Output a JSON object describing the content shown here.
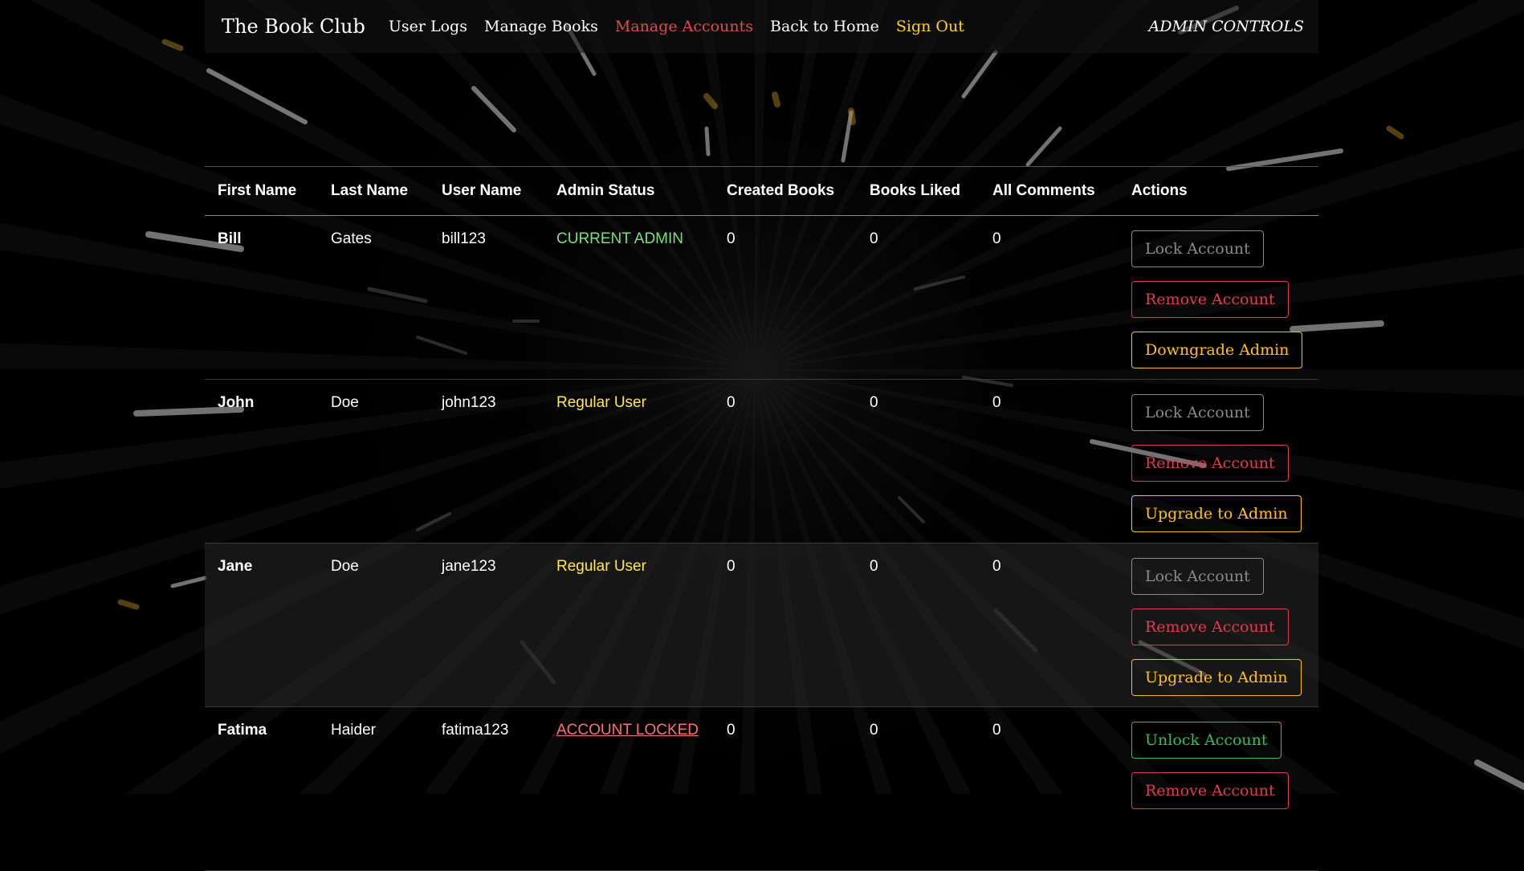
{
  "nav": {
    "brand": "The Book Club",
    "links": [
      "User Logs",
      "Manage Books",
      "Manage Accounts",
      "Back to Home",
      "Sign Out"
    ],
    "right_label": "ADMIN CONTROLS"
  },
  "colors": {
    "active_link": "#e24b4b",
    "sign_out": "#ffd21e",
    "admin_status": "#7be07b",
    "regular_status": "#ffe84a",
    "locked_status": "#ff6f6f",
    "lock_button": "#8a8a8a",
    "remove_button": "#e23b4b",
    "upgrade_button": "#ffc21a",
    "unlock_button": "#2fbf55"
  },
  "table": {
    "headers": [
      "First Name",
      "Last Name",
      "User Name",
      "Admin Status",
      "Created Books",
      "Books Liked",
      "All Comments",
      "Actions"
    ],
    "rows": [
      {
        "first": "Bill",
        "last": "Gates",
        "username": "bill123",
        "status": "CURRENT ADMIN",
        "created": "0",
        "liked": "0",
        "comments": "0",
        "actions": [
          "Lock Account",
          "Remove Account",
          "Downgrade Admin"
        ]
      },
      {
        "first": "John",
        "last": "Doe",
        "username": "john123",
        "status": "Regular User",
        "created": "0",
        "liked": "0",
        "comments": "0",
        "actions": [
          "Lock Account",
          "Remove Account",
          "Upgrade to Admin"
        ]
      },
      {
        "first": "Jane",
        "last": "Doe",
        "username": "jane123",
        "status": "Regular User",
        "created": "0",
        "liked": "0",
        "comments": "0",
        "actions": [
          "Lock Account",
          "Remove Account",
          "Upgrade to Admin"
        ]
      },
      {
        "first": "Fatima",
        "last": "Haider",
        "username": "fatima123",
        "status": "ACCOUNT LOCKED",
        "created": "0",
        "liked": "0",
        "comments": "0",
        "actions": [
          "Unlock Account",
          "Remove Account"
        ]
      }
    ]
  }
}
